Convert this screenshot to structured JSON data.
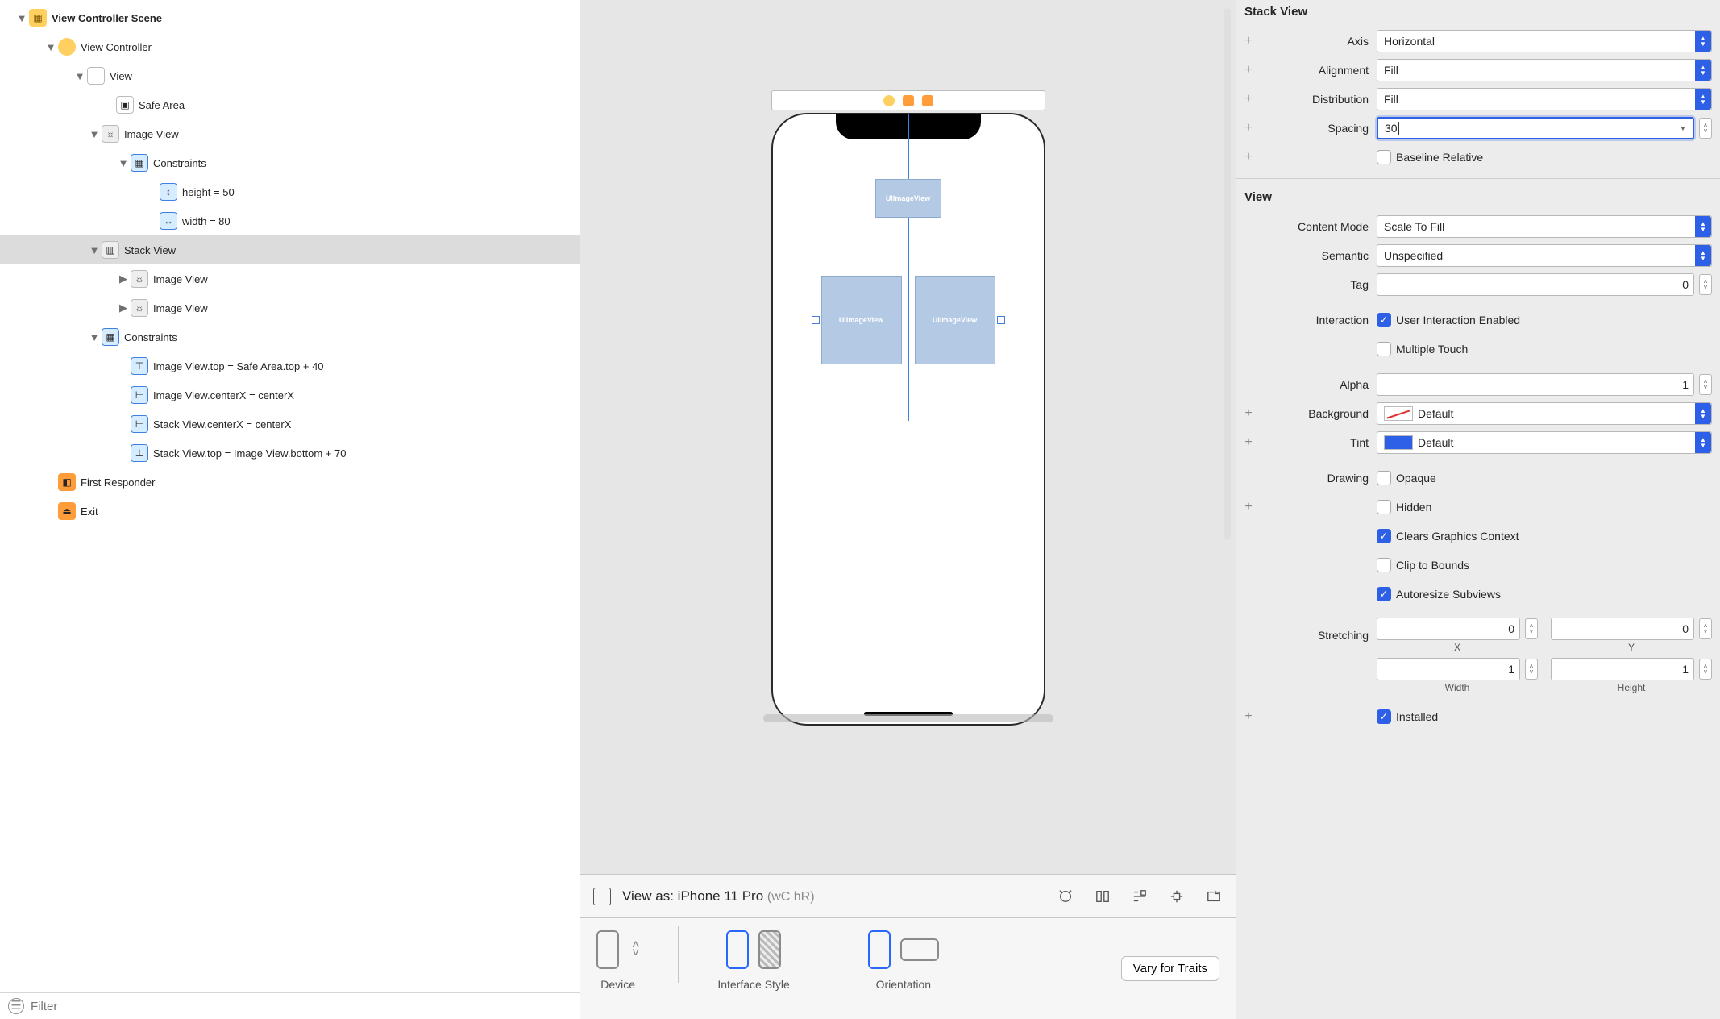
{
  "outline": {
    "scene": "View Controller Scene",
    "vc": "View Controller",
    "view": "View",
    "safeArea": "Safe Area",
    "imageView": "Image View",
    "constraintsLabel": "Constraints",
    "height": "height = 50",
    "width": "width = 80",
    "stackView": "Stack View",
    "iv2": "Image View",
    "iv3": "Image View",
    "c1": "Image View.top = Safe Area.top + 40",
    "c2": "Image View.centerX = centerX",
    "c3": "Stack View.centerX = centerX",
    "c4": "Stack View.top = Image View.bottom + 70",
    "first": "First Responder",
    "exit": "Exit"
  },
  "filter": {
    "placeholder": "Filter"
  },
  "canvas": {
    "uiimageLabel": "UIImageView"
  },
  "bottom": {
    "viewAs": "View as: iPhone 11 Pro ",
    "sizeClass": "(wC hR)",
    "device": "Device",
    "interfaceStyle": "Interface Style",
    "orientation": "Orientation",
    "vary": "Vary for Traits"
  },
  "inspector": {
    "stackSection": "Stack View",
    "axisLabel": "Axis",
    "axisValue": "Horizontal",
    "alignLabel": "Alignment",
    "alignValue": "Fill",
    "distLabel": "Distribution",
    "distValue": "Fill",
    "spacingLabel": "Spacing",
    "spacingValue": "30",
    "baseline": "Baseline Relative",
    "viewSection": "View",
    "contentModeLabel": "Content Mode",
    "contentModeValue": "Scale To Fill",
    "semanticLabel": "Semantic",
    "semanticValue": "Unspecified",
    "tagLabel": "Tag",
    "tagValue": "0",
    "interactionLabel": "Interaction",
    "uie": "User Interaction Enabled",
    "mt": "Multiple Touch",
    "alphaLabel": "Alpha",
    "alphaValue": "1",
    "bgLabel": "Background",
    "bgValue": "Default",
    "tintLabel": "Tint",
    "tintValue": "Default",
    "drawingLabel": "Drawing",
    "opaque": "Opaque",
    "hidden": "Hidden",
    "clears": "Clears Graphics Context",
    "clip": "Clip to Bounds",
    "autoresize": "Autoresize Subviews",
    "stretchLabel": "Stretching",
    "x": "0",
    "y": "0",
    "w": "1",
    "h": "1",
    "xLbl": "X",
    "yLbl": "Y",
    "wLbl": "Width",
    "hLbl": "Height",
    "installed": "Installed"
  }
}
